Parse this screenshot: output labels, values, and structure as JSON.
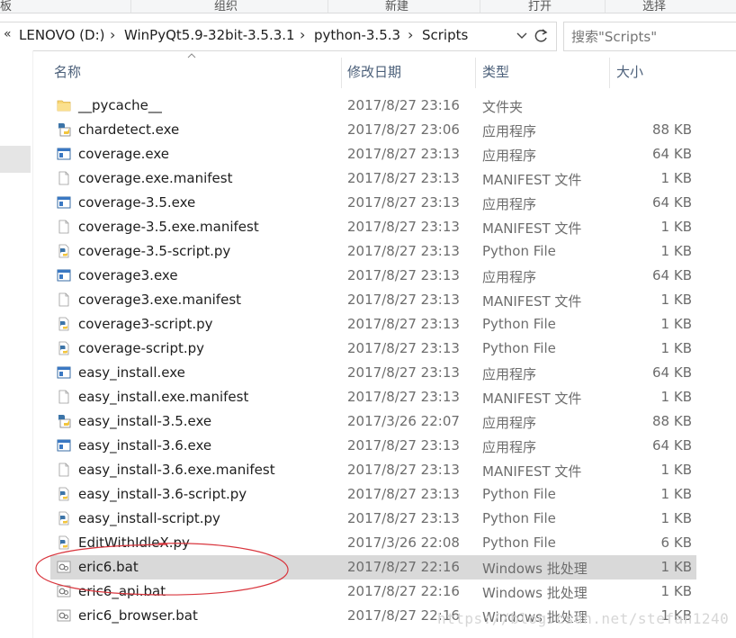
{
  "ribbon": {
    "groups": [
      "板",
      "组织",
      "新建",
      "打开",
      "选择"
    ]
  },
  "address": {
    "lead": "«",
    "crumbs": [
      "LENOVO (D:)",
      "WinPyQt5.9-32bit-3.5.3.1",
      "python-3.5.3",
      "Scripts"
    ],
    "separator": "›"
  },
  "search": {
    "placeholder": "搜索\"Scripts\""
  },
  "columns": {
    "name": "名称",
    "date": "修改日期",
    "type": "类型",
    "size": "大小"
  },
  "files": [
    {
      "name": "__pycache__",
      "date": "2017/8/27 23:16",
      "type": "文件夹",
      "size": "",
      "icon": "folder"
    },
    {
      "name": "chardetect.exe",
      "date": "2017/8/27 23:06",
      "type": "应用程序",
      "size": "88 KB",
      "icon": "python-exe"
    },
    {
      "name": "coverage.exe",
      "date": "2017/8/27 23:13",
      "type": "应用程序",
      "size": "64 KB",
      "icon": "exe"
    },
    {
      "name": "coverage.exe.manifest",
      "date": "2017/8/27 23:13",
      "type": "MANIFEST 文件",
      "size": "1 KB",
      "icon": "file"
    },
    {
      "name": "coverage-3.5.exe",
      "date": "2017/8/27 23:13",
      "type": "应用程序",
      "size": "64 KB",
      "icon": "exe"
    },
    {
      "name": "coverage-3.5.exe.manifest",
      "date": "2017/8/27 23:13",
      "type": "MANIFEST 文件",
      "size": "1 KB",
      "icon": "file"
    },
    {
      "name": "coverage-3.5-script.py",
      "date": "2017/8/27 23:13",
      "type": "Python File",
      "size": "1 KB",
      "icon": "python"
    },
    {
      "name": "coverage3.exe",
      "date": "2017/8/27 23:13",
      "type": "应用程序",
      "size": "64 KB",
      "icon": "exe"
    },
    {
      "name": "coverage3.exe.manifest",
      "date": "2017/8/27 23:13",
      "type": "MANIFEST 文件",
      "size": "1 KB",
      "icon": "file"
    },
    {
      "name": "coverage3-script.py",
      "date": "2017/8/27 23:13",
      "type": "Python File",
      "size": "1 KB",
      "icon": "python"
    },
    {
      "name": "coverage-script.py",
      "date": "2017/8/27 23:13",
      "type": "Python File",
      "size": "1 KB",
      "icon": "python"
    },
    {
      "name": "easy_install.exe",
      "date": "2017/8/27 23:13",
      "type": "应用程序",
      "size": "64 KB",
      "icon": "exe"
    },
    {
      "name": "easy_install.exe.manifest",
      "date": "2017/8/27 23:13",
      "type": "MANIFEST 文件",
      "size": "1 KB",
      "icon": "file"
    },
    {
      "name": "easy_install-3.5.exe",
      "date": "2017/3/26 22:07",
      "type": "应用程序",
      "size": "88 KB",
      "icon": "python-exe"
    },
    {
      "name": "easy_install-3.6.exe",
      "date": "2017/8/27 23:13",
      "type": "应用程序",
      "size": "64 KB",
      "icon": "exe"
    },
    {
      "name": "easy_install-3.6.exe.manifest",
      "date": "2017/8/27 23:13",
      "type": "MANIFEST 文件",
      "size": "1 KB",
      "icon": "file"
    },
    {
      "name": "easy_install-3.6-script.py",
      "date": "2017/8/27 23:13",
      "type": "Python File",
      "size": "1 KB",
      "icon": "python"
    },
    {
      "name": "easy_install-script.py",
      "date": "2017/8/27 23:13",
      "type": "Python File",
      "size": "1 KB",
      "icon": "python"
    },
    {
      "name": "EditWithIdleX.py",
      "date": "2017/3/26 22:08",
      "type": "Python File",
      "size": "6 KB",
      "icon": "python"
    },
    {
      "name": "eric6.bat",
      "date": "2017/8/27 22:16",
      "type": "Windows 批处理",
      "size": "1 KB",
      "icon": "bat",
      "selected": true
    },
    {
      "name": "eric6_api.bat",
      "date": "2017/8/27 22:16",
      "type": "Windows 批处理",
      "size": "1 KB",
      "icon": "bat"
    },
    {
      "name": "eric6_browser.bat",
      "date": "2017/8/27 22:16",
      "type": "Windows 批处理",
      "size": "1 KB",
      "icon": "bat"
    }
  ],
  "watermark": "https://blog.csdn.net/stefan1240"
}
